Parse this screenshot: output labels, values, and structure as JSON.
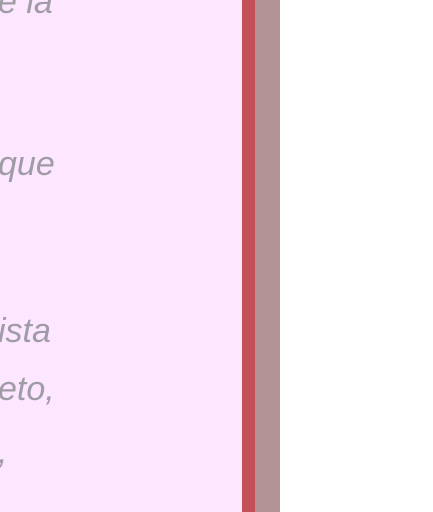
{
  "panel": {
    "background": "#fde6ff",
    "text_color": "#a09ca6",
    "lines": [
      "e la",
      "que",
      "ista",
      "eto,",
      ","
    ]
  },
  "frame": {
    "accent_color": "#c45158",
    "edge_color": "#b49396"
  }
}
